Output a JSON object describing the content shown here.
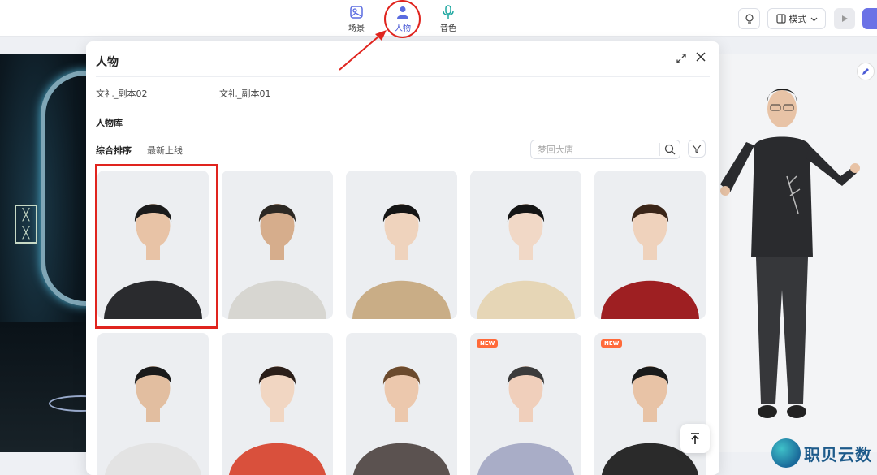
{
  "topbar": {
    "nav": [
      {
        "label": "场景",
        "icon": "scene-icon"
      },
      {
        "label": "人物",
        "icon": "person-icon"
      },
      {
        "label": "音色",
        "icon": "microphone-icon"
      }
    ],
    "mode_label": "模式"
  },
  "panel": {
    "title": "人物",
    "recent": [
      "文礼_副本02",
      "文礼_副本01"
    ],
    "library_title": "人物库",
    "sort_tabs": [
      "综合排序",
      "最新上线"
    ],
    "search_placeholder": "梦回大唐",
    "cards": [
      {
        "name": "avatar-card-1",
        "suit": "#2a2b2e",
        "skin": "#e8c3a6",
        "hair": "#1b1b1b",
        "badge": ""
      },
      {
        "name": "avatar-card-2",
        "suit": "#d7d6d1",
        "skin": "#d6ad8c",
        "hair": "#2c2823",
        "badge": ""
      },
      {
        "name": "avatar-card-3",
        "suit": "#c9ad86",
        "skin": "#efd3bd",
        "hair": "#151515",
        "badge": ""
      },
      {
        "name": "avatar-card-4",
        "suit": "#e6d6b6",
        "skin": "#f1d8c6",
        "hair": "#151515",
        "badge": ""
      },
      {
        "name": "avatar-card-5",
        "suit": "#9e1f22",
        "skin": "#efd2bc",
        "hair": "#3a2518",
        "badge": ""
      },
      {
        "name": "avatar-card-6",
        "suit": "#e3e3e3",
        "skin": "#e2bea0",
        "hair": "#1a1a1a",
        "badge": ""
      },
      {
        "name": "avatar-card-7",
        "suit": "#d9503c",
        "skin": "#f1d6c2",
        "hair": "#2b1f1a",
        "badge": ""
      },
      {
        "name": "avatar-card-8",
        "suit": "#5b5250",
        "skin": "#ecc8ad",
        "hair": "#6b4a2d",
        "badge": ""
      },
      {
        "name": "avatar-card-9",
        "suit": "#a9adc7",
        "skin": "#f0cfbb",
        "hair": "#3b3b3b",
        "badge": "NEW"
      },
      {
        "name": "avatar-card-10",
        "suit": "#2a2a2a",
        "skin": "#e8c3a6",
        "hair": "#1a1a1a",
        "badge": "NEW"
      }
    ]
  },
  "watermark": "职贝云数",
  "colors": {
    "accent": "#6b72e6",
    "highlight": "#e0241e"
  }
}
